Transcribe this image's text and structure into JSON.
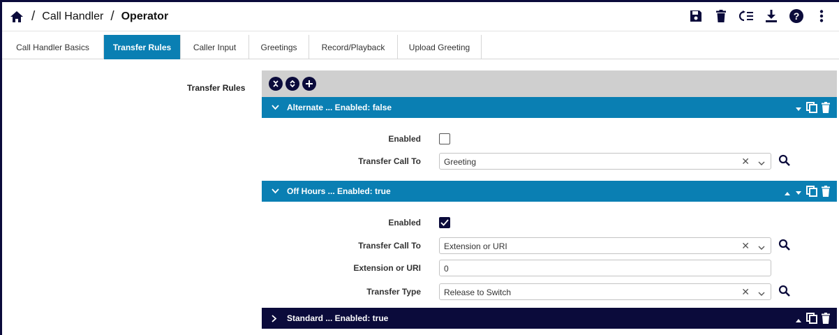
{
  "breadcrumb": {
    "items": [
      "Call Handler",
      "Operator"
    ],
    "separator": "/"
  },
  "toolbar_icons": [
    "save-icon",
    "delete-icon",
    "reorder-icon",
    "download-icon",
    "help-icon",
    "more-icon"
  ],
  "tabs": [
    {
      "label": "Call Handler Basics",
      "active": false
    },
    {
      "label": "Transfer Rules",
      "active": true
    },
    {
      "label": "Caller Input",
      "active": false
    },
    {
      "label": "Greetings",
      "active": false
    },
    {
      "label": "Record/Playback",
      "active": false
    },
    {
      "label": "Upload Greeting",
      "active": false
    }
  ],
  "section_label": "Transfer Rules",
  "rules": [
    {
      "title": "Alternate ... Enabled: false",
      "expanded": true,
      "enabled_label": "Enabled",
      "enabled": false,
      "transfer_label": "Transfer Call To",
      "transfer_value": "Greeting"
    },
    {
      "title": "Off Hours ... Enabled: true",
      "expanded": true,
      "enabled_label": "Enabled",
      "enabled": true,
      "transfer_label": "Transfer Call To",
      "transfer_value": "Extension or URI",
      "extension_label": "Extension or URI",
      "extension_value": "0",
      "type_label": "Transfer Type",
      "type_value": "Release to Switch"
    },
    {
      "title": "Standard ... Enabled: true",
      "expanded": false
    }
  ],
  "colors": {
    "accent": "#0a7fb3",
    "navy": "#0b0b3b",
    "toolbar_gray": "#cfcfcf"
  }
}
